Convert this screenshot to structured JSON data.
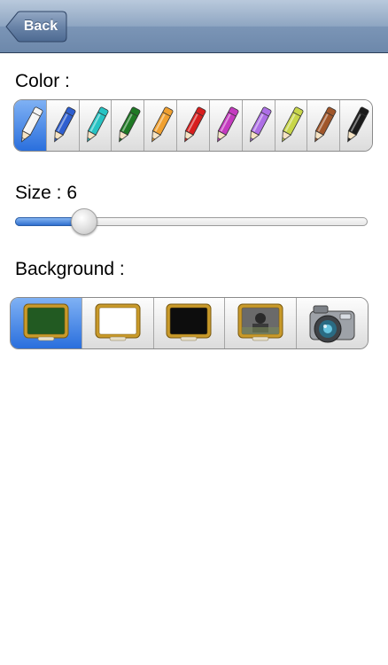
{
  "navbar": {
    "back_label": "Back"
  },
  "color": {
    "label": "Color :",
    "selected_index": 0,
    "pencils": [
      {
        "name": "white-pencil-icon",
        "color": "#f4f4f4"
      },
      {
        "name": "blue-pencil-icon",
        "color": "#2f5fd0"
      },
      {
        "name": "cyan-pencil-icon",
        "color": "#27c3c3"
      },
      {
        "name": "green-pencil-icon",
        "color": "#1f7a25"
      },
      {
        "name": "orange-pencil-icon",
        "color": "#f0a030"
      },
      {
        "name": "red-pencil-icon",
        "color": "#d81e1e"
      },
      {
        "name": "magenta-pencil-icon",
        "color": "#c43bbf"
      },
      {
        "name": "lavender-pencil-icon",
        "color": "#ad6fe6"
      },
      {
        "name": "lime-pencil-icon",
        "color": "#c8d64a"
      },
      {
        "name": "brown-pencil-icon",
        "color": "#a0562a"
      },
      {
        "name": "black-pencil-icon",
        "color": "#1b1b1b"
      }
    ]
  },
  "size": {
    "label": "Size : 6",
    "value": 6,
    "min": 1,
    "max": 30
  },
  "background": {
    "label": "Background :",
    "selected_index": 0,
    "options": [
      {
        "name": "green-chalkboard-icon",
        "board_color": "#225a22"
      },
      {
        "name": "white-board-icon",
        "board_color": "#ffffff"
      },
      {
        "name": "black-board-icon",
        "board_color": "#0d0d0d"
      },
      {
        "name": "photo-board-icon",
        "board_color": "#6a6a6a"
      },
      {
        "name": "camera-icon",
        "board_color": "#8a8a8a"
      }
    ]
  }
}
